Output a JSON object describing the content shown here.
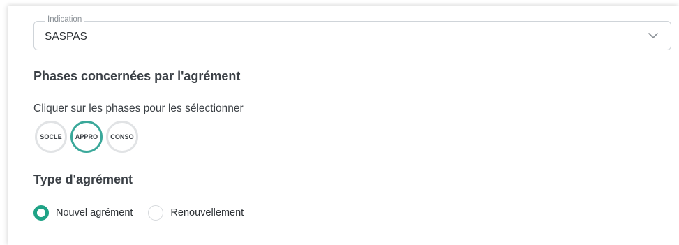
{
  "indication": {
    "legend": "Indication",
    "value": "SASPAS",
    "icon": "chevron-down-icon"
  },
  "phases": {
    "title": "Phases concernées par l'agrément",
    "hint": "Cliquer sur les phases pour les sélectionner",
    "items": [
      {
        "label": "SOCLE",
        "selected": false
      },
      {
        "label": "APPRO",
        "selected": true
      },
      {
        "label": "CONSO",
        "selected": false
      }
    ]
  },
  "agrement_type": {
    "title": "Type d'agrément",
    "options": [
      {
        "label": "Nouvel agrément",
        "checked": true
      },
      {
        "label": "Renouvellement",
        "checked": false
      }
    ]
  },
  "colors": {
    "selected_phase_border": "#3aa89a",
    "radio_checked": "#1fa386"
  }
}
